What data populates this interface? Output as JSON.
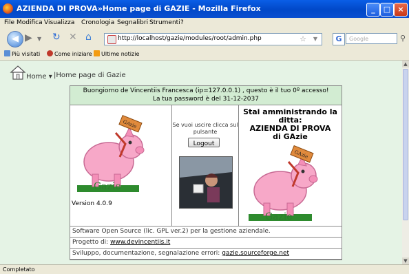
{
  "window": {
    "title": "AZIENDA DI PROVA»Home page di GAZIE - Mozilla Firefox",
    "controls": {
      "minimize": "_",
      "maximize": "□",
      "close": "×"
    }
  },
  "menu": [
    "File",
    "Modifica",
    "Visualizza",
    "Cronologia",
    "Segnalibri",
    "Strumenti",
    "?"
  ],
  "nav": {
    "url": "http://localhost/gazie/modules/root/admin.php",
    "search_placeholder": "Google"
  },
  "bookmarks": [
    "Più visitati",
    "Come iniziare",
    "Ultime notizie"
  ],
  "page": {
    "home_label": "Home",
    "breadcrumb": "|Home page di Gazie",
    "greeting": "Buongiorno de Vincentiis Francesca (ip=127.0.0.1) , questo è il tuo 0º accesso!",
    "password_notice": "La tua password è del 31-12-2037",
    "version": "Version 4.0.9",
    "logout_prompt": "Se vuoi uscire clicca sul pulsante",
    "logout_button": "Logout",
    "admin_line1": "Stai amministrando la ditta:",
    "admin_line2": "AZIENDA DI PROVA",
    "admin_line3": "di GAzie",
    "logo_word": "Gazie",
    "tag_word": "GAzie",
    "license": "Software Open Source (lic. GPL ver.2) per la gestione aziendale.",
    "project_label": "Progetto di: ",
    "project_link": "www.devincentiis.it",
    "dev_label": "Sviluppo, documentazione, segnalazione errori: ",
    "dev_link": "gazie.sourceforge.net"
  },
  "status": "Completato",
  "colors": {
    "titlebar": "#0148c8",
    "page_background": "#e5f3e5",
    "header_background": "#d2ecd2",
    "pig": "#f7a8c8"
  }
}
